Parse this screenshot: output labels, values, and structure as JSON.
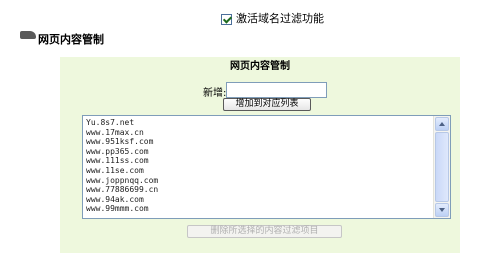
{
  "filter_toggle": {
    "label": "激活域名过滤功能",
    "checked": true
  },
  "section": {
    "title": "网页内容管制"
  },
  "panel": {
    "title": "网页内容管制",
    "add_label": "新增:",
    "add_input_value": "",
    "add_button": "增加到对应列表",
    "list_items": [
      "Yu.8s7.net",
      "www.17max.cn",
      "www.951ksf.com",
      "www.pp365.com",
      "www.111ss.com",
      "www.11se.com",
      "www.joppnqq.com",
      "www.77886699.cn",
      "www.94ak.com",
      "www.99mmm.com"
    ],
    "delete_button": "删除所选择的内容过滤项目"
  }
}
